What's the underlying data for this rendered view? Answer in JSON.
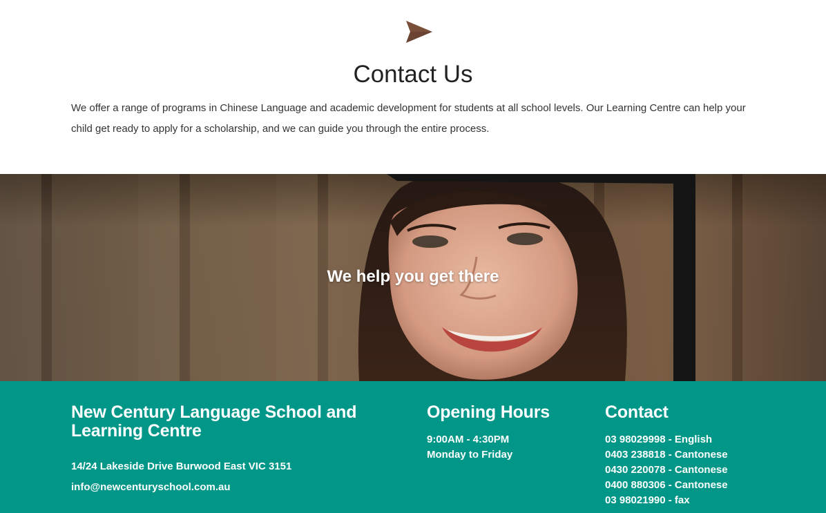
{
  "intro": {
    "icon": "paper-plane-send-icon",
    "title": "Contact Us",
    "text": "We offer a range of programs in Chinese Language and academic development for students at all school levels. Our Learning Centre can help your child get ready to apply for a scholarship, and we can guide you through the entire process."
  },
  "hero": {
    "tagline": "We help you get there"
  },
  "footer": {
    "school": {
      "heading": "New Century Language School and Learning Centre",
      "address": "14/24 Lakeside Drive Burwood East VIC 3151",
      "email": "info@newcenturyschool.com.au"
    },
    "hours": {
      "heading": "Opening Hours",
      "lines": [
        "9:00AM - 4:30PM",
        "Monday to Friday"
      ]
    },
    "contact": {
      "heading": "Contact",
      "lines": [
        "03 98029998 - English",
        "0403 238818 - Cantonese",
        "0430 220078 - Cantonese",
        "0400 880306 - Cantonese",
        "03 98021990 - fax"
      ]
    }
  },
  "colors": {
    "icon": "#7a4f3a",
    "footer_bg": "#009688",
    "text_dark": "#222222",
    "white": "#ffffff"
  }
}
